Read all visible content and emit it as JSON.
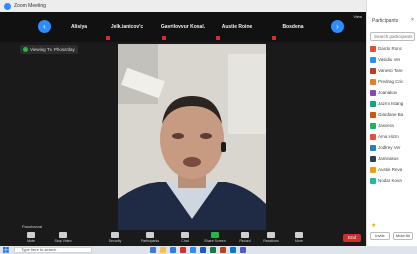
{
  "window": {
    "title": "Zoom Meeting"
  },
  "gallery": {
    "view_label": "View",
    "tiles": [
      {
        "name": "Alisiya",
        "muted": false
      },
      {
        "name": "Jelk.ianicov'c",
        "muted": true
      },
      {
        "name": "Gavrilovvur Kosal.",
        "muted": true
      },
      {
        "name": "Austie Roine",
        "muted": true
      },
      {
        "name": "Bosdena",
        "muted": true
      }
    ]
  },
  "share_bar": {
    "presenter_label": "Viewing Tx",
    "presenter_name": "Phosa'day",
    "options_label": "Viewing #",
    "status_label": "VS"
  },
  "video": {
    "speaker_label": "Paosharvai"
  },
  "toolbar": {
    "items": [
      {
        "label": "Mute",
        "icon": "microphone-icon"
      },
      {
        "label": "Stop Video",
        "icon": "video-camera-icon"
      },
      {
        "label": "Security",
        "icon": "shield-icon"
      },
      {
        "label": "Participants",
        "icon": "participants-icon"
      },
      {
        "label": "Chat",
        "icon": "chat-icon"
      },
      {
        "label": "Share Screen",
        "icon": "share-screen-icon"
      },
      {
        "label": "Record",
        "icon": "record-icon"
      },
      {
        "label": "Reactions",
        "icon": "reactions-icon"
      },
      {
        "label": "More",
        "icon": "more-icon"
      }
    ],
    "end_label": "End"
  },
  "panel": {
    "title": "Participants",
    "close_symbol": "×",
    "search_placeholder": "Search participants",
    "participants": [
      {
        "name": "Dardo Ronc",
        "color": "#e24c3b"
      },
      {
        "name": "Vasidiu Ver",
        "color": "#2d8cff"
      },
      {
        "name": "Vanesti Tare",
        "color": "#c0392b"
      },
      {
        "name": "Predrag Cric",
        "color": "#e67e22"
      },
      {
        "name": "Joanakov",
        "color": "#8e44ad"
      },
      {
        "name": "Jazmi Istang",
        "color": "#16a085"
      },
      {
        "name": "Giardane Ba",
        "color": "#d35400"
      },
      {
        "name": "Jasvera",
        "color": "#27ae60"
      },
      {
        "name": "Ama Hizm",
        "color": "#e74c3c"
      },
      {
        "name": "Jodlrey Ver",
        "color": "#2980b9"
      },
      {
        "name": "Jamirakus",
        "color": "#2c3e50"
      },
      {
        "name": "Austie Reva",
        "color": "#f39c12"
      },
      {
        "name": "Nodar Kova",
        "color": "#1abc9c"
      }
    ],
    "invite_label": "Invite",
    "mute_all_label": "Mute All"
  },
  "taskbar": {
    "search_placeholder": "Type here to search"
  }
}
